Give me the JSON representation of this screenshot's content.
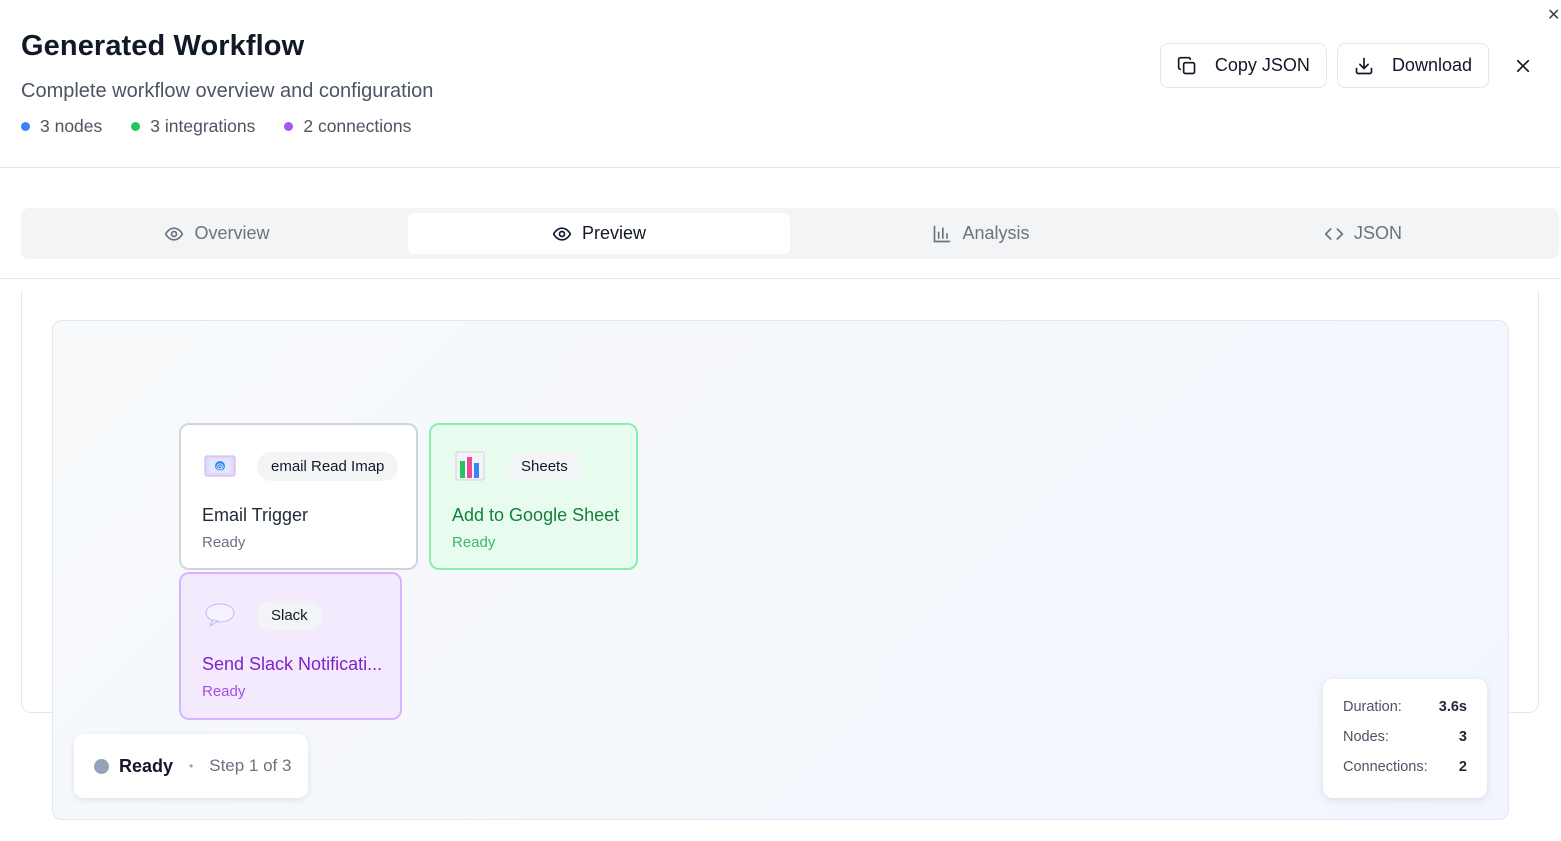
{
  "header": {
    "title": "Generated Workflow",
    "subtitle": "Complete workflow overview and configuration",
    "stats": [
      {
        "label": "3 nodes",
        "color": "#3b82f6"
      },
      {
        "label": "3 integrations",
        "color": "#22c55e"
      },
      {
        "label": "2 connections",
        "color": "#a855f7"
      }
    ],
    "actions": {
      "copy_label": "Copy JSON",
      "download_label": "Download"
    }
  },
  "tabs": [
    {
      "label": "Overview",
      "icon": "eye-icon",
      "active": false
    },
    {
      "label": "Preview",
      "icon": "eye-icon",
      "active": true
    },
    {
      "label": "Analysis",
      "icon": "bar-chart-icon",
      "active": false
    },
    {
      "label": "JSON",
      "icon": "code-icon",
      "active": false
    }
  ],
  "nodes": [
    {
      "badge": "email Read Imap",
      "name": "Email Trigger",
      "status": "Ready",
      "icon": "email-icon"
    },
    {
      "badge": "Sheets",
      "name": "Add to Google Sheet",
      "status": "Ready",
      "icon": "sheets-icon"
    },
    {
      "badge": "Slack",
      "name": "Send Slack Notificati...",
      "status": "Ready",
      "icon": "speech-bubble-icon"
    }
  ],
  "status_bar": {
    "state": "Ready",
    "separator": "•",
    "step": "Step 1 of 3"
  },
  "metrics": [
    {
      "label": "Duration:",
      "value": "3.6s"
    },
    {
      "label": "Nodes:",
      "value": "3"
    },
    {
      "label": "Connections:",
      "value": "2"
    }
  ],
  "colors": {
    "accent_green": "#15803d",
    "accent_purple": "#7e22ce",
    "status_dot": "#94a3b8"
  }
}
